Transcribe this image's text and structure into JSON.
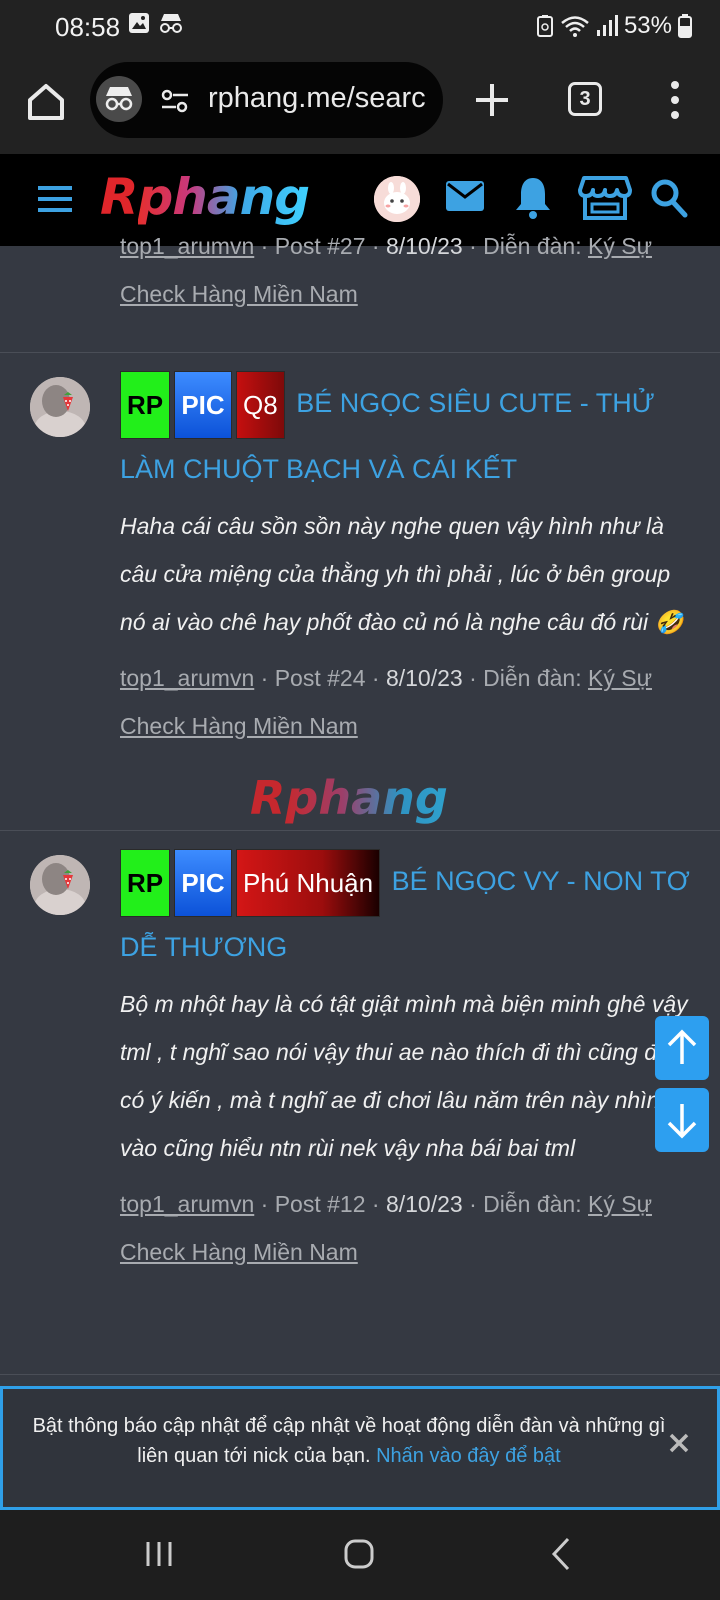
{
  "status_bar": {
    "time": "08:58",
    "battery": "53%"
  },
  "browser": {
    "url": "rphang.me/search",
    "tab_count": "3"
  },
  "site_header": {
    "logo_r": "R",
    "logo_rest": "phang"
  },
  "posts": [
    {
      "title": "",
      "meta": {
        "user": "top1_arumvn",
        "post_no": "Post #27",
        "date": "8/10/23",
        "forum_label": "Diễn đàn:",
        "forum_line1": "Ký Sự",
        "forum_line2": "Check Hàng Miền Nam"
      }
    },
    {
      "tags": [
        "RP",
        "PIC",
        "Q8"
      ],
      "title": "BÉ NGỌC SIÊU CUTE - THỬ LÀM CHUỘT BẠCH VÀ CÁI KẾT",
      "title_line1": "BÉ NGỌC SIÊU CUTE - THỬ",
      "title_line2": "LÀM CHUỘT BẠCH VÀ CÁI KẾT",
      "snippet": "Haha cái câu sồn sồn này nghe quen vậy hình như là câu cửa miệng của thằng yh thì phải , lúc ở bên group nó ai vào chê hay phốt đào củ nó là nghe câu đó rùi 🤣",
      "meta": {
        "user": "top1_arumvn",
        "post_no": "Post #24",
        "date": "8/10/23",
        "forum_label": "Diễn đàn:",
        "forum_line1": "Ký Sự",
        "forum_line2": "Check Hàng Miền Nam"
      }
    },
    {
      "tags": [
        "RP",
        "PIC",
        "Phú Nhuận"
      ],
      "title_line1": "BÉ NGỌC VY - NON TƠ",
      "title_line2": "DỄ THƯƠNG",
      "snippet": "Bộ m nhột hay là có tật giật mình mà biện minh ghê vậy tml , t nghĩ sao nói vậy thui ae nào thích đi thì cũng đâu có ý kiến , mà t nghĩ ae đi chơi lâu năm trên này nhìn vào cũng hiểu ntn rùi nek vậy nha bái bai tml",
      "meta": {
        "user": "top1_arumvn",
        "post_no": "Post #12",
        "date": "8/10/23",
        "forum_label": "Diễn đàn:",
        "forum_line1": "Ký Sự",
        "forum_line2": "Check Hàng Miền Nam"
      }
    }
  ],
  "watermark": {
    "r": "R",
    "rest": "phang"
  },
  "notification": {
    "text": "Bật thông báo cập nhật để cập nhật về hoạt động diễn đàn và những gì liên quan tới nick của bạn.",
    "link": "Nhấn vào đây để bật"
  },
  "colors": {
    "link_blue": "#3da2e2",
    "tag_green": "#22ef1a",
    "tag_blue": "#1a6cf0",
    "tag_red": "#c50f0f",
    "background": "#353942"
  }
}
